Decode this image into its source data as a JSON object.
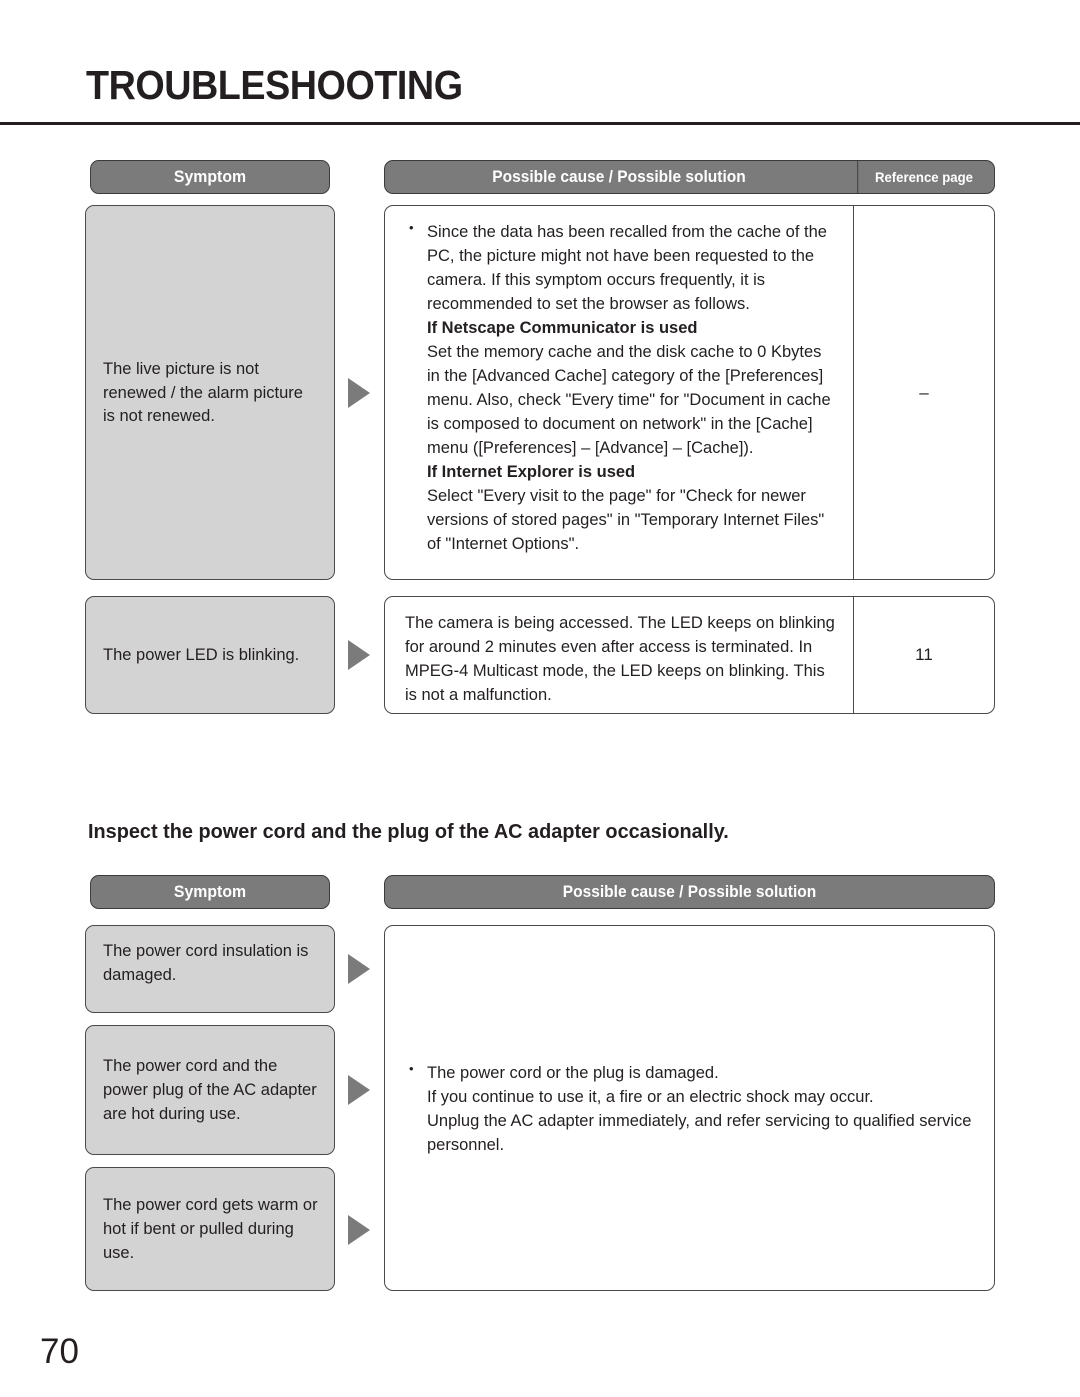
{
  "page": {
    "title": "TROUBLESHOOTING",
    "number": "70",
    "mid_heading": "Inspect the power cord and the plug of the AC adapter occasionally."
  },
  "colors": {
    "header_gray": "#7b7b7b",
    "symptom_fill": "#d3d3d3",
    "border": "#4a4a4a",
    "text": "#231f20",
    "arrow": "#7b7b7b"
  },
  "table1": {
    "headers": {
      "symptom": "Symptom",
      "cause": "Possible cause / Possible solution",
      "reference": "Reference page"
    },
    "rows": [
      {
        "symptom": "The live picture is not renewed / the alarm picture is not renewed.",
        "bullet": "Since the data has been recalled from the cache of the PC, the picture might not have been requested to the camera. If this symptom occurs frequently, it is recommended to set the browser as follows.",
        "sub1_head": "If Netscape Communicator is used",
        "sub1_body": "Set the memory cache and the disk cache to 0 Kbytes in the [Advanced Cache] category of the [Preferences] menu. Also, check \"Every time\" for \"Document in cache is composed to document on network\" in the [Cache] menu ([Preferences] – [Advance] – [Cache]).",
        "sub2_head": "If Internet Explorer is used",
        "sub2_body": "Select \"Every visit to the page\" for \"Check for newer versions of stored pages\" in \"Temporary Internet Files\" of \"Internet Options\".",
        "reference": "–"
      },
      {
        "symptom": "The power LED is blinking.",
        "body": "The camera is being accessed. The LED keeps on blinking for around 2 minutes even after access is terminated. In MPEG-4 Multicast mode, the LED keeps on blinking. This is not a malfunction.",
        "reference": "11"
      }
    ]
  },
  "table2": {
    "headers": {
      "symptom": "Symptom",
      "cause": "Possible cause / Possible solution"
    },
    "symptoms": [
      "The power cord insulation is damaged.",
      "The power cord and the power plug of the AC adapter are hot during use.",
      "The power cord gets warm or hot if bent or pulled during use."
    ],
    "solution": {
      "bullet": "The power cord or the plug is damaged.",
      "line2": "If you continue to use it, a fire or an electric shock may occur.",
      "line3": "Unplug the AC adapter immediately, and refer servicing to qualified service personnel."
    }
  }
}
